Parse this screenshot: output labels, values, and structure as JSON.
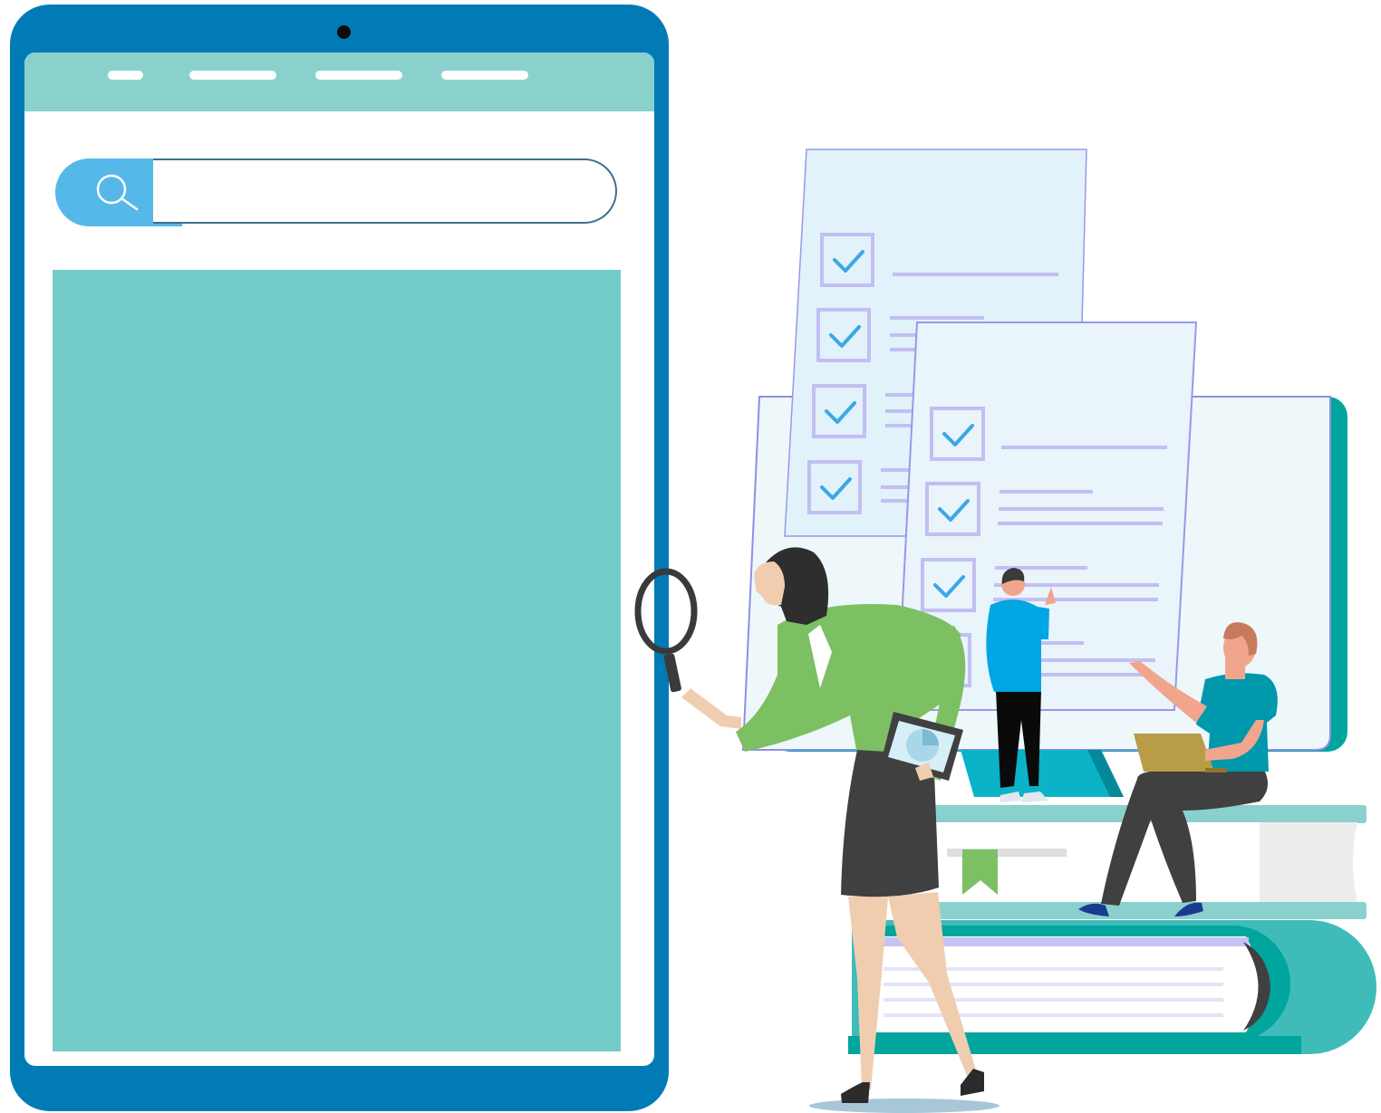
{
  "tablet": {
    "nav_items": [
      {
        "id": "nav-1"
      },
      {
        "id": "nav-2"
      },
      {
        "id": "nav-3"
      },
      {
        "id": "nav-4"
      }
    ],
    "search": {
      "placeholder": "",
      "value": "",
      "icon": "search-icon"
    }
  },
  "illustration": {
    "checklist_back": {
      "items": 4,
      "checked": 4
    },
    "checklist_front": {
      "items": 4,
      "checked": 4
    }
  },
  "colors": {
    "tablet_frame": "#007bb6",
    "nav_bar": "#8ad1cd",
    "search_button": "#56b8e8",
    "content_panel": "#73cbc7",
    "checkbox": "#b9b5f2",
    "checkmark": "#45a9e6",
    "jacket_green": "#7cc063",
    "book_teal": "#3fbcb9"
  }
}
